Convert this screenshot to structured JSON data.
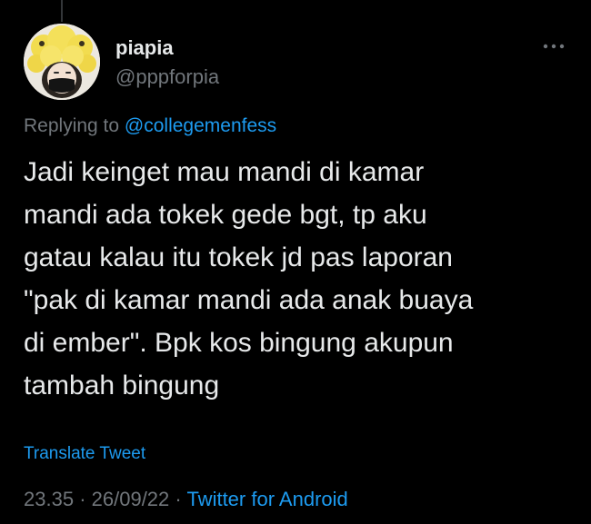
{
  "author": {
    "display_name": "piapia",
    "handle": "@pppforpia"
  },
  "reply": {
    "prefix": "Replying to",
    "mention": "@collegemenfess"
  },
  "tweet": {
    "lines": [
      "Jadi keinget mau mandi di kamar",
      "mandi ada tokek gede bgt, tp aku",
      "gatau kalau itu tokek jd pas laporan",
      "\"pak di kamar mandi ada anak buaya",
      "di ember\". Bpk kos bingung akupun",
      "tambah bingung"
    ]
  },
  "translate_label": "Translate Tweet",
  "meta": {
    "time": "23.35",
    "separator": "·",
    "date": "26/09/22",
    "source": "Twitter for Android"
  },
  "icons": {
    "more": "more-horizontal-icon"
  },
  "colors": {
    "background": "#000000",
    "text": "#e7e9ea",
    "secondary": "#71767b",
    "accent": "#1d9bf0"
  }
}
